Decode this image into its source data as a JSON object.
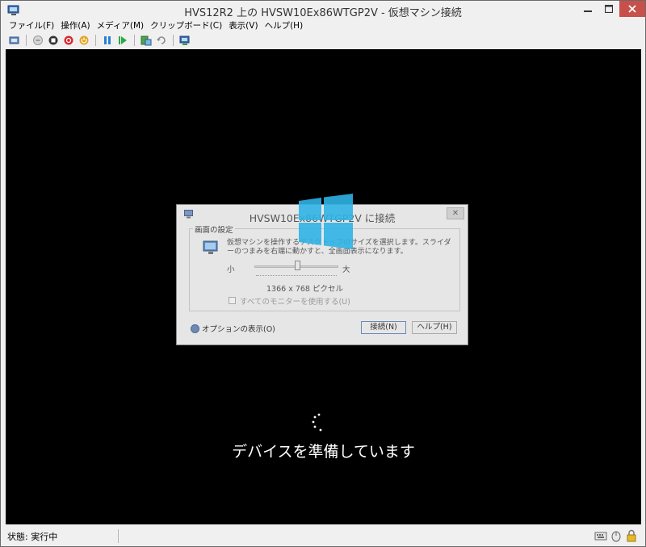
{
  "window": {
    "title": "HVS12R2 上の HVSW10Ex86WTGP2V  - 仮想マシン接続",
    "min_icon": "minimize-icon",
    "max_icon": "maximize-icon",
    "close_icon": "close-icon"
  },
  "menu": {
    "items": [
      {
        "label": "ファイル(F)"
      },
      {
        "label": "操作(A)"
      },
      {
        "label": "メディア(M)"
      },
      {
        "label": "クリップボード(C)"
      },
      {
        "label": "表示(V)"
      },
      {
        "label": "ヘルプ(H)"
      }
    ]
  },
  "toolbar": {
    "icons": [
      "ctrl-alt-del-icon",
      "start-icon",
      "turn-off-icon",
      "shutdown-icon",
      "save-icon",
      "pause-icon",
      "resume-icon",
      "checkpoint-icon",
      "revert-icon",
      "enhanced-session-icon"
    ]
  },
  "vm": {
    "dialog": {
      "title": "HVSW10Ex86WTGP2V に接続",
      "group_label": "画面の設定",
      "description": "仮想マシンを操作するデスクトップのサイズを選択します。スライダーのつまみを右端に動かすと、全画面表示になります。",
      "slider_small": "小",
      "slider_large": "大",
      "slider_level": 0.5,
      "resolution": "1366 x 768 ピクセル",
      "all_monitors_label": "すべてのモニターを使用する(U)",
      "options_label": "オプションの表示(O)",
      "connect_label": "接続(N)",
      "help_label": "ヘルプ(H)",
      "close_glyph": "✕"
    },
    "preparing_text": "デバイスを準備しています",
    "logo_color": "#2fb3e6"
  },
  "status": {
    "text": "状態: 実行中"
  }
}
